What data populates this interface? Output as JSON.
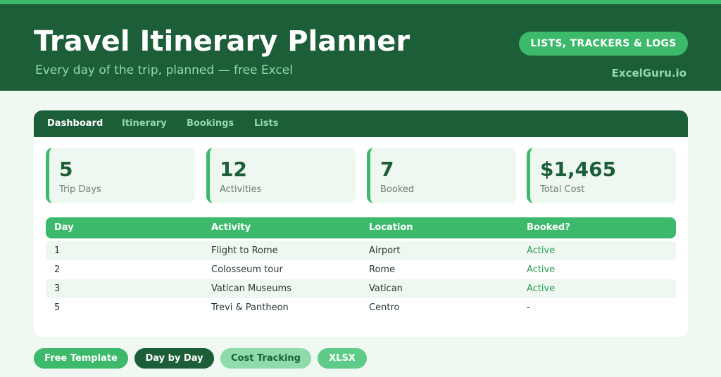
{
  "header": {
    "title": "Travel Itinerary Planner",
    "subtitle": "Every day of the trip, planned — free Excel",
    "category_pill": "LISTS, TRACKERS & LOGS",
    "brand": "ExcelGuru.io"
  },
  "tabs": [
    {
      "label": "Dashboard",
      "active": true
    },
    {
      "label": "Itinerary",
      "active": false
    },
    {
      "label": "Bookings",
      "active": false
    },
    {
      "label": "Lists",
      "active": false
    }
  ],
  "stats": [
    {
      "value": "5",
      "label": "Trip Days"
    },
    {
      "value": "12",
      "label": "Activities"
    },
    {
      "value": "7",
      "label": "Booked"
    },
    {
      "value": "$1,465",
      "label": "Total Cost"
    }
  ],
  "table": {
    "columns": [
      "Day",
      "Activity",
      "Location",
      "Booked?"
    ],
    "rows": [
      [
        "1",
        "Flight to Rome",
        "Airport",
        "Active"
      ],
      [
        "2",
        "Colosseum tour",
        "Rome",
        "Active"
      ],
      [
        "3",
        "Vatican Museums",
        "Vatican",
        "Active"
      ],
      [
        "5",
        "Trevi & Pantheon",
        "Centro",
        "-"
      ]
    ]
  },
  "chips": [
    "Free Template",
    "Day by Day",
    "Cost Tracking",
    "XLSX"
  ],
  "colors": {
    "dark_green": "#1c5e37",
    "accent_green": "#3cb96a",
    "light_green": "#8fdcaa",
    "background": "#f0f8f2",
    "status_active": "#2e9d57"
  }
}
